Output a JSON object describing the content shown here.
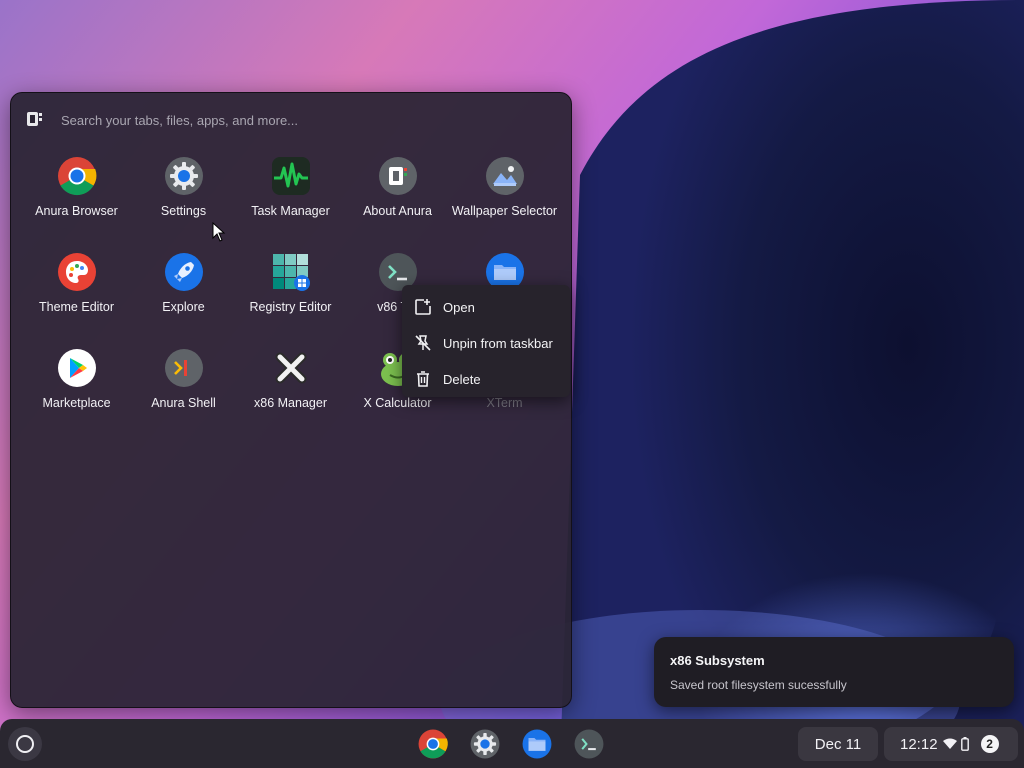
{
  "search": {
    "placeholder": "Search your tabs, files, apps, and more..."
  },
  "apps": [
    {
      "label": "Anura Browser",
      "icon": "chrome-icon"
    },
    {
      "label": "Settings",
      "icon": "gear-icon"
    },
    {
      "label": "Task Manager",
      "icon": "activity-monitor-icon"
    },
    {
      "label": "About Anura",
      "icon": "anura-logo-icon"
    },
    {
      "label": "Wallpaper Selector",
      "icon": "wallpaper-icon"
    },
    {
      "label": "Theme Editor",
      "icon": "palette-icon"
    },
    {
      "label": "Explore",
      "icon": "rocket-icon"
    },
    {
      "label": "Registry Editor",
      "icon": "registry-grid-icon"
    },
    {
      "label": "v86 Ter",
      "icon": "terminal-icon"
    },
    {
      "label": "",
      "icon": "folder-icon"
    },
    {
      "label": "Marketplace",
      "icon": "play-store-icon"
    },
    {
      "label": "Anura Shell",
      "icon": "shell-icon"
    },
    {
      "label": "x86 Manager",
      "icon": "x-mark-icon"
    },
    {
      "label": "X Calculator",
      "icon": "frog-icon"
    },
    {
      "label": "XTerm",
      "icon": "xterm-icon"
    }
  ],
  "context_menu": {
    "items": [
      {
        "label": "Open",
        "icon": "open-window-icon"
      },
      {
        "label": "Unpin from taskbar",
        "icon": "unpin-icon"
      },
      {
        "label": "Delete",
        "icon": "trash-icon"
      }
    ]
  },
  "notification": {
    "title": "x86 Subsystem",
    "body": "Saved root filesystem sucessfully"
  },
  "taskbar": {
    "pinned": [
      {
        "name": "chrome-icon"
      },
      {
        "name": "gear-icon"
      },
      {
        "name": "folder-icon"
      },
      {
        "name": "terminal-icon"
      }
    ],
    "date": "Dec 11",
    "time": "12:12",
    "notification_count": "2"
  },
  "colors": {
    "accent_blue": "#1a73e8",
    "panel": "#2a2434",
    "taskbar": "#2a2730"
  }
}
